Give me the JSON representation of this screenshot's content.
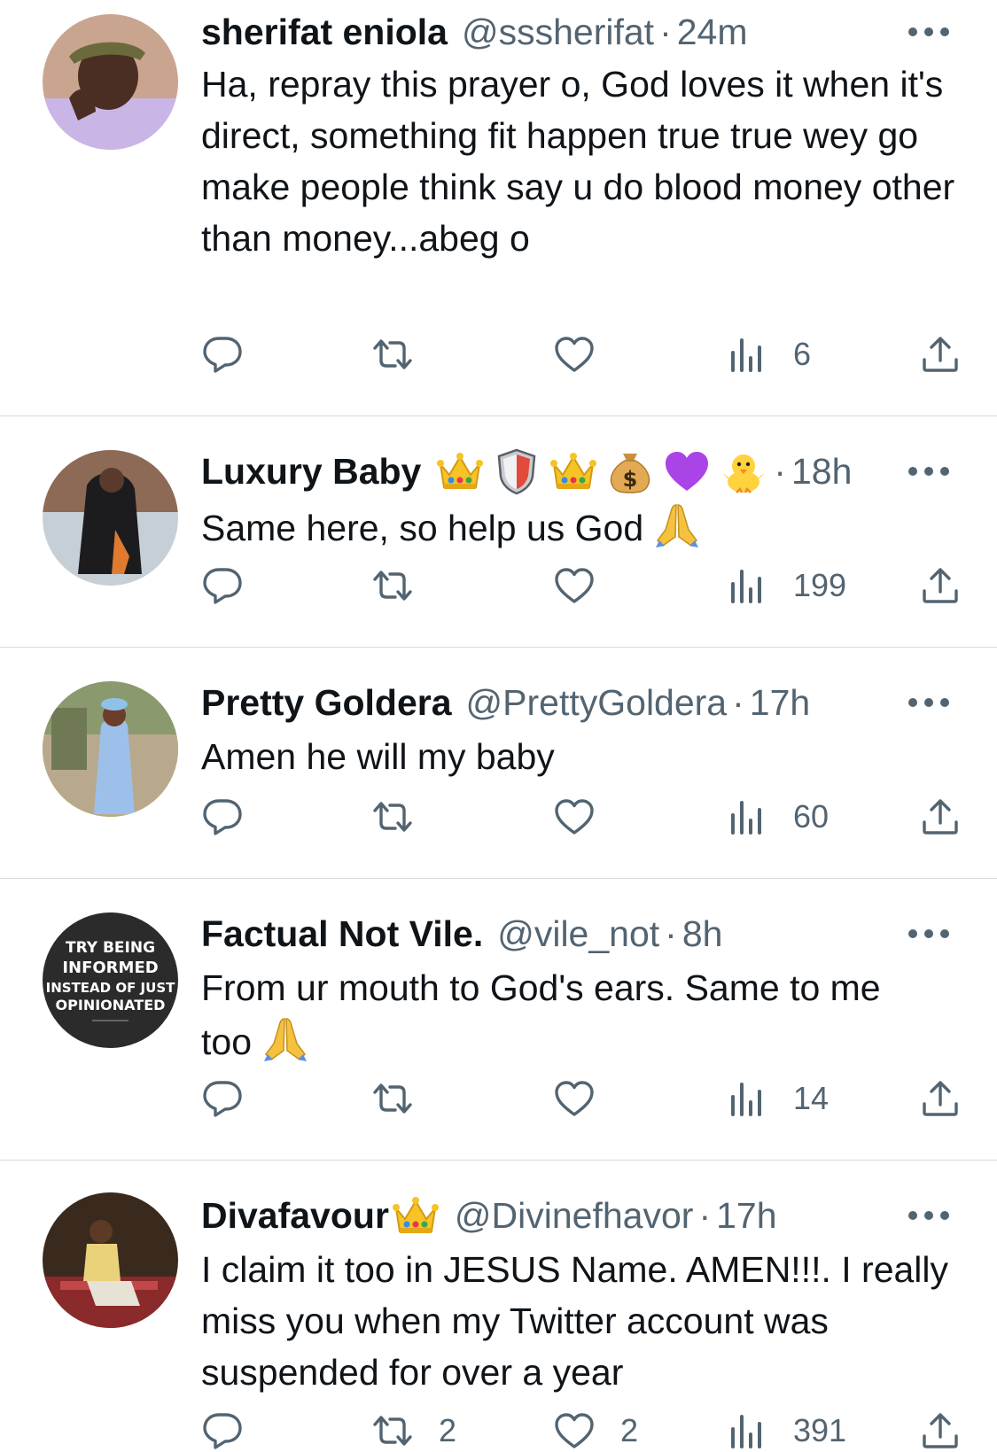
{
  "colors": {
    "text": "#0f1419",
    "muted": "#536471",
    "divider": "#d6dbdf"
  },
  "tweets": [
    {
      "name": "sherifat eniola",
      "handle": "@sssherifat",
      "time": "24m",
      "text": "Ha, repray this prayer o, God loves it when it's direct, something fit happen true true wey go make people think say u do blood money other than money...abeg o",
      "reply_count": "",
      "retweet_count": "",
      "like_count": "",
      "views": "6"
    },
    {
      "name": "Luxury Baby",
      "name_emojis": [
        "crown-emoji",
        "shield-emoji",
        "crown-emoji",
        "money-bag-emoji",
        "purple-heart-emoji",
        "chick-emoji"
      ],
      "handle": "",
      "time": "18h",
      "text": "Same here, so help us God",
      "text_emoji": "folded-hands-emoji",
      "reply_count": "",
      "retweet_count": "",
      "like_count": "",
      "views": "199"
    },
    {
      "name": "Pretty Goldera",
      "handle": "@PrettyGoldera",
      "time": "17h",
      "text": "Amen he will my baby",
      "reply_count": "",
      "retweet_count": "",
      "like_count": "",
      "views": "60"
    },
    {
      "name": "Factual Not Vile.",
      "handle": "@vile_not",
      "time": "8h",
      "text": "From ur mouth to God's ears. Same to me too",
      "text_emoji": "folded-hands-emoji",
      "avatar_text": [
        "TRY BEING",
        "INFORMED",
        "INSTEAD OF JUST",
        "OPINIONATED"
      ],
      "reply_count": "",
      "retweet_count": "",
      "like_count": "",
      "views": "14"
    },
    {
      "name": "Divafavour",
      "name_emojis": [
        "crown-emoji"
      ],
      "handle": "@Divinefhavor",
      "time": "17h",
      "text": "I claim it too in JESUS Name. AMEN!!!. I really miss you when my Twitter account was suspended for over a year",
      "reply_count": "",
      "retweet_count": "2",
      "like_count": "2",
      "views": "391"
    }
  ]
}
